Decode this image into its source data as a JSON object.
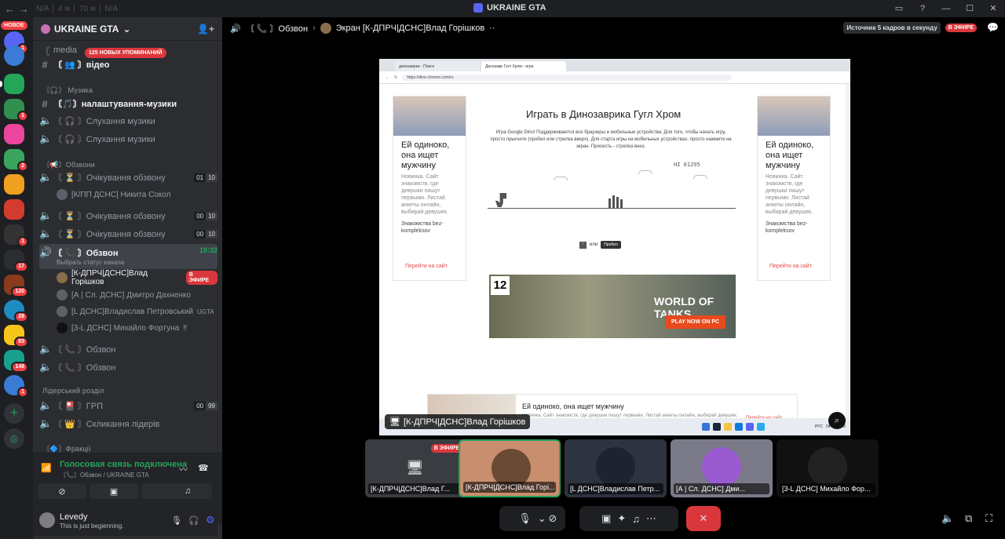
{
  "titlebar": {
    "title": "UKRAINE GTA",
    "faint": "N/A   │   4 м   │   70 м   │   N/A"
  },
  "rail": {
    "new_label": "НОВОЕ",
    "badges": [
      "1",
      "",
      "1",
      "",
      "1",
      "2",
      "",
      "",
      "1",
      "17",
      "120",
      "28",
      "93",
      "148",
      "1"
    ]
  },
  "sidebar": {
    "guild_name": "UKRAINE GTA",
    "mention_pill": "125 НОВЫХ УПОМИНАНИЙ",
    "channels": {
      "media": "media",
      "video": "〘 👥 〙відео",
      "cat_music": "〘🎧〙 Музика",
      "music_settings": "〘🎵〙налаштування-музики",
      "music_listen_1": "〘 🎧 〙Слухання музики",
      "music_listen_2": "〘 🎧 〙Слухання музики",
      "cat_calls": "〘📢〙Обзвони",
      "waiting_1": "〘 ⏳ 〙Очікування обзвону",
      "waiting_1_counts": [
        "01",
        "10"
      ],
      "waiting_1_user": "[К/ПП ДСНС] Никита Сокол",
      "waiting_2": "〘 ⏳ 〙Очікування обзвону",
      "waiting_2_counts": [
        "00",
        "10"
      ],
      "waiting_3": "〘 ⏳ 〙Очікування обзвону",
      "waiting_3_counts": [
        "00",
        "10"
      ],
      "obzvon_active": "〘 📞 〙Обзвон",
      "obzvon_time": "18:32",
      "obzvon_status": "Выбрать статус канала",
      "users": [
        {
          "name": "[К-ДПРЧ|ДСНС]Влад Горішков",
          "live": "В ЭФИРЕ"
        },
        {
          "name": "[А | Сл. ДСНС] Дмитро Дахненко"
        },
        {
          "name": "[L ДСНС]Владислав Петровський",
          "extra": "UGTA"
        },
        {
          "name": "[3-L ДСНС] Михайло Фортуна",
          "extra": "‼"
        }
      ],
      "obzvon_2": "〘 📞 〙Обзвон",
      "obzvon_3": "〘 📞 〙Обзвон",
      "cat_leaders": "Лідерський розділ",
      "grp": "〘 🎴 〙ГРП",
      "grp_counts": [
        "00",
        "99"
      ],
      "leaders_call": "〘 👑 〙Скликання лідерів",
      "cat_factions": "〘🔷〙Фракції"
    },
    "voice": {
      "status": "Голосовая связь подключена",
      "sub": "〘📞〙Обзвон / UKRAINE GTA"
    },
    "user": {
      "name": "Levedy",
      "status": "This is just begienning."
    }
  },
  "main": {
    "channel": "〘 📞 〙Обзвон",
    "screen_label": "Экран [К-ДПРЧ|ДСНС]Влад Горішков",
    "source_info": "Источник 5 кадров в секунду",
    "live": "В ЭФИРЕ",
    "stream_owner": "[К-ДПРЧ|ДСНС]Влад Горішков"
  },
  "browser": {
    "tab1": "динозаврик - Поиск",
    "tab2": "Динозавр Гугл Хром - игра",
    "url": "https://dino-chrome.com/ru",
    "game_title": "Играть в Динозаврика Гугл Хром",
    "game_desc": "Игра Google Dino! Поддерживаются все браузеры и мобильные устройства. Для того, чтобы начать игру, просто прыгните (пробел или стрелка вверх). Для старта игры на мобильных устройствах, просто нажмите на экран. Присесть - стрелка вниз.",
    "hi_score": "HI 01295",
    "keys_or": "или",
    "keys_space": "Пробел",
    "ad_title": "Ей одиноко, она ищет мужчину",
    "ad_text": "Новинка. Сайт знакомств, где девушки пишут первыми. Листай анкеты онлайн, выбирай девушек.",
    "ad_sponsor": "Знакомства bez-kompleksov",
    "ad_link": "Перейти на сайт",
    "wot_age": "12",
    "wot_title": "WORLD OF TANKS",
    "wot_play": "PLAY NOW ON PC",
    "tray_lang": "РУС",
    "tray_date": "04.02.2026"
  },
  "tiles": [
    {
      "label": "[К-ДПРЧ|ДСНС]Влад Г...",
      "live": "В ЭФИРЕ"
    },
    {
      "label": "[К-ДПРЧ|ДСНС]Влад Горі..."
    },
    {
      "label": "[L ДСНС]Владислав Петр..."
    },
    {
      "label": "[А | Сл. ДСНС] Дми..."
    },
    {
      "label": "[3-L ДСНС] Михайло Фор..."
    }
  ],
  "colors": {
    "accent": "#5865f2",
    "live": "#da373c",
    "green": "#23a55a"
  }
}
